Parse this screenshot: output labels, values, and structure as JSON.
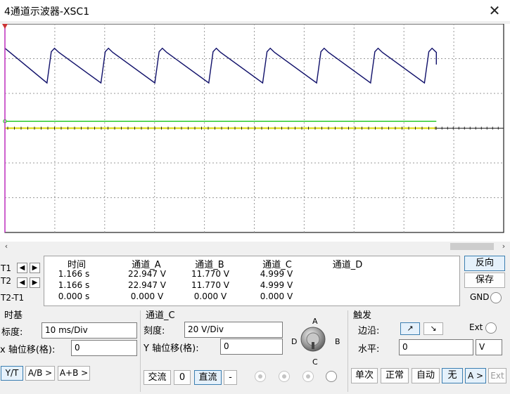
{
  "window": {
    "title": "4通道示波器-XSC1",
    "close_glyph": "✕"
  },
  "scope": {
    "background": "#ffffff",
    "grid_color": "#9a9a9a",
    "trace_a_color": "#10106a",
    "trace_b_color": "#00c000",
    "trace_c_color": "#d8d800",
    "cursor_color": "#cc33cc",
    "trace_a_divs": {
      "max": -2.3,
      "min": -1.3,
      "teeth": 8
    },
    "trace_b_div": 0.2,
    "trace_c_div": 0
  },
  "measurements": {
    "headers": [
      "时间",
      "通道_A",
      "通道_B",
      "通道_C",
      "通道_D"
    ],
    "rows": [
      {
        "label": "T1",
        "time": "1.166 s",
        "a": "22.947 V",
        "b": "11.770 V",
        "c": "4.999 V",
        "d": ""
      },
      {
        "label": "T2",
        "time": "1.166 s",
        "a": "22.947 V",
        "b": "11.770 V",
        "c": "4.999 V",
        "d": ""
      },
      {
        "label": "T2-T1",
        "time": "0.000 s",
        "a": "0.000 V",
        "b": "0.000 V",
        "c": "0.000 V",
        "d": ""
      }
    ],
    "arrow_left": "◀",
    "arrow_right": "▶"
  },
  "side_buttons": {
    "reverse": "反向",
    "save": "保存",
    "gnd": "GND"
  },
  "timebase": {
    "title": "时基",
    "scale_label": "标度:",
    "scale_value": "10 ms/Div",
    "xpos_label": "x 轴位移(格):",
    "xpos_value": "0",
    "modes": [
      "Y/T",
      "A/B >",
      "A+B >"
    ]
  },
  "channel": {
    "title": "通道_C",
    "scale_label": "刻度:",
    "scale_value": "20  V/Div",
    "ypos_label": "Y 轴位移(格):",
    "ypos_value": "0",
    "coupling": [
      "交流",
      "0",
      "直流",
      "-"
    ],
    "knob_labels": {
      "a": "A",
      "b": "B",
      "c": "C",
      "d": "D"
    }
  },
  "trigger": {
    "title": "触发",
    "edge_label": "边沿:",
    "edge_rise": "↗",
    "edge_fall": "↘",
    "ext_label": "Ext",
    "level_label": "水平:",
    "level_value": "0",
    "level_unit": "V",
    "modes": [
      "单次",
      "正常",
      "自动",
      "无",
      "A >",
      "Ext"
    ]
  }
}
